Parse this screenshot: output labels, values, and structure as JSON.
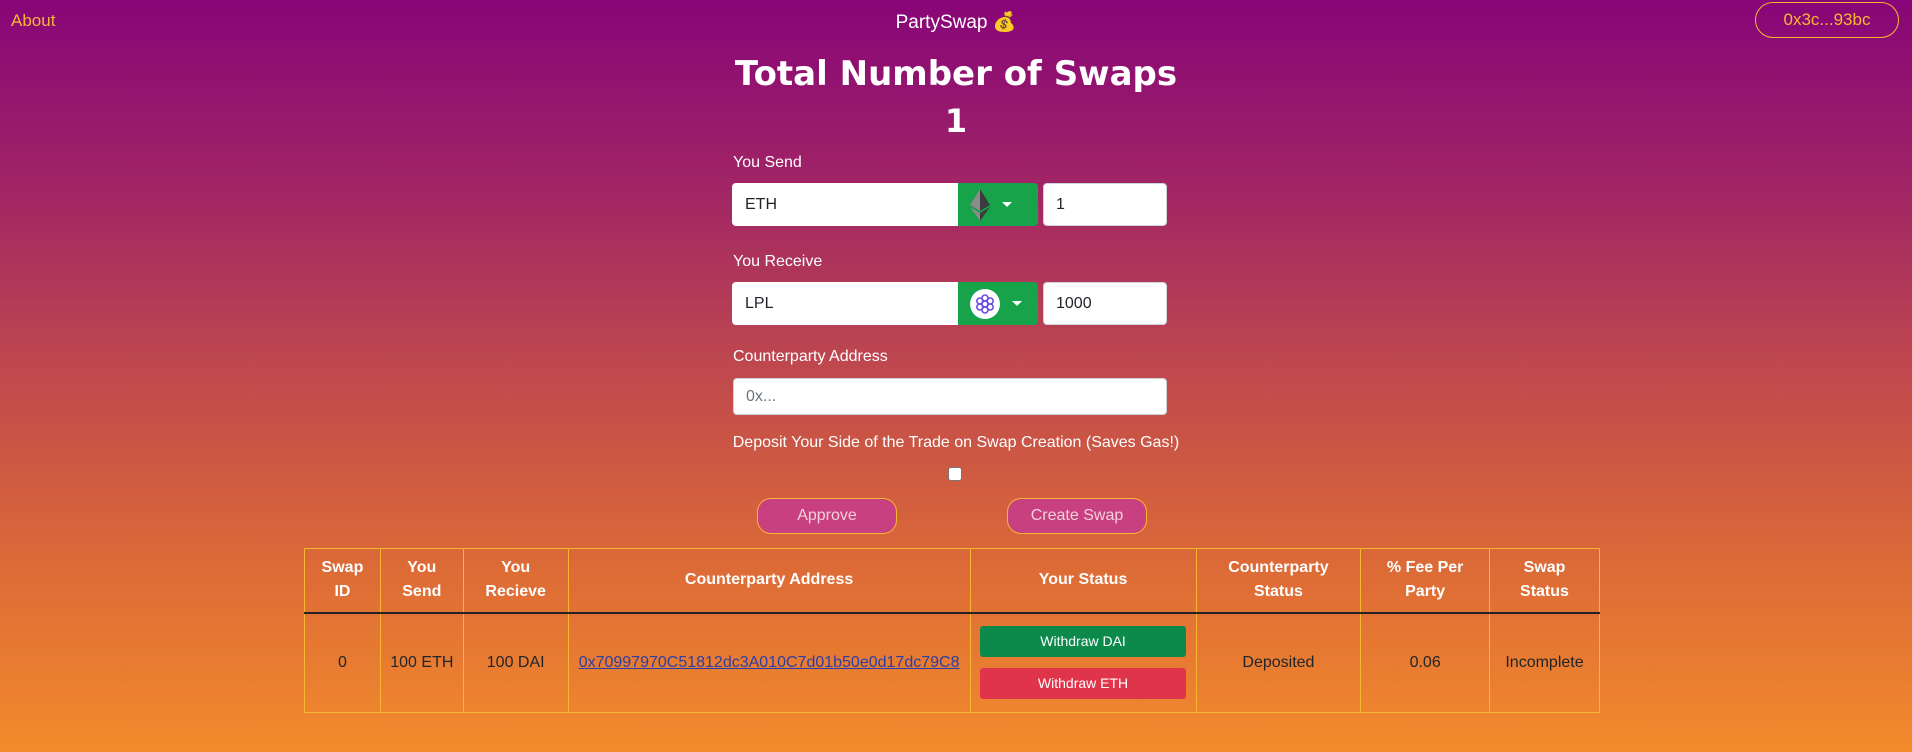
{
  "nav": {
    "about_label": "About",
    "brand": "PartySwap 💰",
    "wallet_label": "0x3c...93bc"
  },
  "header": {
    "title": "Total Number of Swaps",
    "swap_count": "1"
  },
  "send": {
    "label": "You Send",
    "token": "ETH",
    "token_icon": "ethereum-icon",
    "amount": "1"
  },
  "receive": {
    "label": "You Receive",
    "token": "LPL",
    "token_icon": "livepeer-icon",
    "amount": "1000"
  },
  "counterparty": {
    "label": "Counterparty Address",
    "placeholder": "0x..."
  },
  "deposit": {
    "label": "Deposit Your Side of the Trade on Swap Creation (Saves Gas!)",
    "checked": false
  },
  "actions": {
    "approve_label": "Approve",
    "create_label": "Create Swap"
  },
  "table": {
    "headers": {
      "swap_id": [
        "Swap",
        "ID"
      ],
      "you_send": [
        "You",
        "Send"
      ],
      "you_recieve": [
        "You",
        "Recieve"
      ],
      "counterparty_address": "Counterparty Address",
      "your_status": "Your Status",
      "counterparty_status": [
        "Counterparty",
        "Status"
      ],
      "fee": [
        "% Fee Per",
        "Party"
      ],
      "swap_status": [
        "Swap",
        "Status"
      ]
    },
    "rows": [
      {
        "swap_id": "0",
        "you_send": "100 ETH",
        "you_recieve": "100 DAI",
        "counterparty_address": "0x70997970C51812dc3A010C7d01b50e0d17dc79C8",
        "your_status_actions": [
          "Withdraw DAI",
          "Withdraw ETH"
        ],
        "counterparty_status": "Deposited",
        "fee": "0.06",
        "swap_status": "Incomplete"
      }
    ]
  },
  "colors": {
    "accent": "#f7b733",
    "button_green": "#16a34a",
    "withdraw_green": "#0b8a4b",
    "withdraw_red": "#e0344a",
    "pill_button": "#c8407f",
    "gradient_top": "#870578",
    "gradient_bottom": "#f38b2c"
  }
}
